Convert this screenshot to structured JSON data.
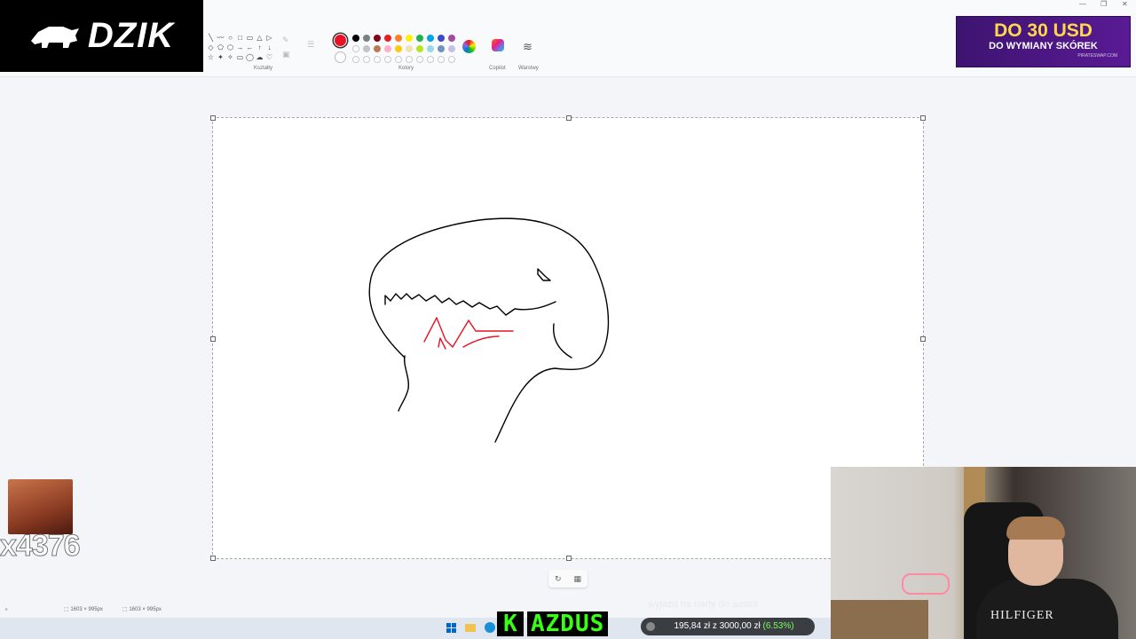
{
  "logo": {
    "text": "DZIK"
  },
  "ribbon": {
    "groups": {
      "shapes": "Kształty",
      "colors": "Kolory",
      "copilot": "Copilot",
      "layers": "Warstwy"
    },
    "shape_glyphs": [
      "╲",
      "〰",
      "○",
      "□",
      "▭",
      "△",
      "▷",
      "◇",
      "⬠",
      "⬡",
      "→",
      "←",
      "↑",
      "↓",
      "☆",
      "✦",
      "✧",
      "▭",
      "◯",
      "☁",
      "♡"
    ],
    "palette": [
      "#000000",
      "#7f7f7f",
      "#880015",
      "#ed1c24",
      "#ff7f27",
      "#fff200",
      "#22b14c",
      "#00a2e8",
      "#3f48cc",
      "#a349a4",
      "#ffffff",
      "#c3c3c3",
      "#b97a57",
      "#ffaec9",
      "#ffc90e",
      "#efe4b0",
      "#b5e61d",
      "#99d9ea",
      "#7092be",
      "#c8bfe7",
      "#ffffff",
      "#ffffff",
      "#ffffff",
      "#ffffff",
      "#ffffff",
      "#ffffff",
      "#ffffff",
      "#ffffff",
      "#ffffff",
      "#ffffff"
    ],
    "current_color": "#e81224"
  },
  "window_controls": {
    "minimize": "—",
    "restore": "❐",
    "close": "✕"
  },
  "ad": {
    "headline": "DO 30 USD",
    "subline": "DO WYMIANY SKÓREK",
    "site": "PIRATESWAP.COM"
  },
  "statusbar": {
    "selection_size": "1603 × 995px",
    "canvas_size": "1603 × 995px"
  },
  "overlay": {
    "emote_count": "x4376",
    "kazdus_initial": "K",
    "kazdus_name": "AZDUS",
    "goal_title": "wyjazd na narty do austrii",
    "goal_amount": "195,84 zł z 3000,00 zł",
    "goal_percent": "(6.53%)"
  },
  "webcam": {
    "shirt_text": "HILFIGER"
  },
  "colors": {
    "stroke_black": "#000000",
    "stroke_red": "#e81224"
  }
}
